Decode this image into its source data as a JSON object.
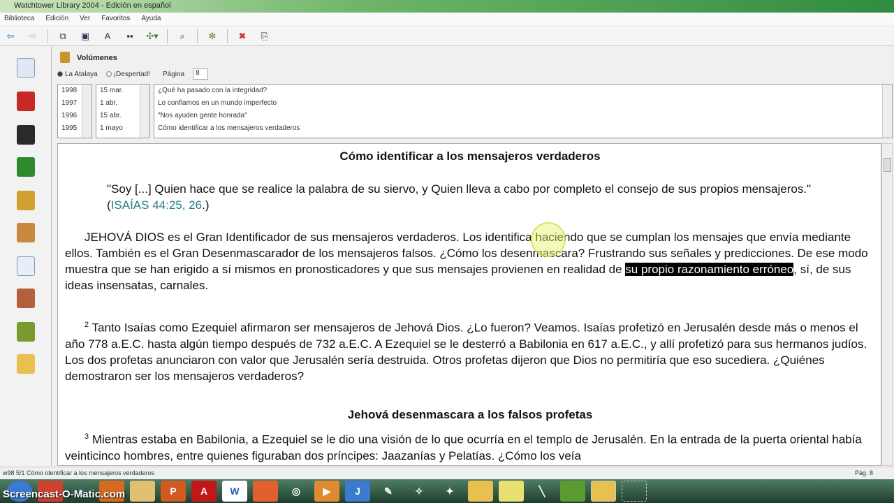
{
  "window": {
    "title": "Watchtower Library 2004 - Edición en español"
  },
  "menu": [
    "Biblioteca",
    "Edición",
    "Ver",
    "Favoritos",
    "Ayuda"
  ],
  "volumes": {
    "header": "Volúmenes",
    "radio1": "La Atalaya",
    "radio2": "¡Despertad!",
    "page_label": "Página",
    "page_value": "8",
    "years": [
      "1998",
      "1997",
      "1996",
      "1995"
    ],
    "dates": [
      "15 mar.",
      "1 abr.",
      "15 abr.",
      "1 mayo"
    ],
    "articles": [
      "¿Qué ha pasado con la integridad?",
      "Lo confiamos en un mundo imperfecto",
      "\"Nos ayuden gente honrada\"",
      "Cómo identificar a los mensajeros verdaderos"
    ]
  },
  "article": {
    "title": "Cómo identificar a los mensajeros verdaderos",
    "quote": "\"Soy [...] Quien hace que se realice la palabra de su siervo, y Quien lleva a cabo por completo el consejo de sus propios mensajeros.\" (",
    "quote_ref": "ISAÍAS 44:25, 26",
    "quote_end": ".)",
    "p1_a": "JEHOVÁ DIOS es el Gran Identificador de sus mensajeros verdaderos. Los identifica haciendo que se cumplan los mensajes que envía mediante ellos. También es el Gran Desenmascarador de los mensajeros falsos. ¿Cómo los desenmascara? Frustrando sus señales y predicciones. De ese modo muestra que se han erigido a sí mismos en pronosticadores y que sus mensajes provienen en realidad de ",
    "p1_hl": "su propio razonamiento erróneo",
    "p1_b": ", sí, de sus ideas insensatas, carnales.",
    "p2_num": "2",
    "p2": " Tanto Isaías como Ezequiel afirmaron ser mensajeros de Jehová Dios. ¿Lo fueron? Veamos. Isaías profetizó en Jerusalén desde más o menos el año 778 a.E.C. hasta algún tiempo después de 732 a.E.C. A Ezequiel se le desterró a Babilonia en 617 a.E.C., y allí profetizó para sus hermanos judíos. Los dos profetas anunciaron con valor que Jerusalén sería destruida. Otros profetas dijeron que Dios no permitiría que eso sucediera. ¿Quiénes demostraron ser los mensajeros verdaderos?",
    "subtitle": "Jehová desenmascara a los falsos profetas",
    "p3_num": "3",
    "p3": " Mientras estaba en Babilonia, a Ezequiel se le dio una visión de lo que ocurría en el templo de Jerusalén. En la entrada de la puerta oriental había veinticinco hombres, entre quienes figuraban dos príncipes: Jaazanías y Pelatías. ¿Cómo los veía"
  },
  "status": {
    "left": "w98 5/1 Cómo identificar a los mensajeros verdaderos",
    "right": "Pág. 8"
  },
  "watermark": "Screencast-O-Matic.com"
}
